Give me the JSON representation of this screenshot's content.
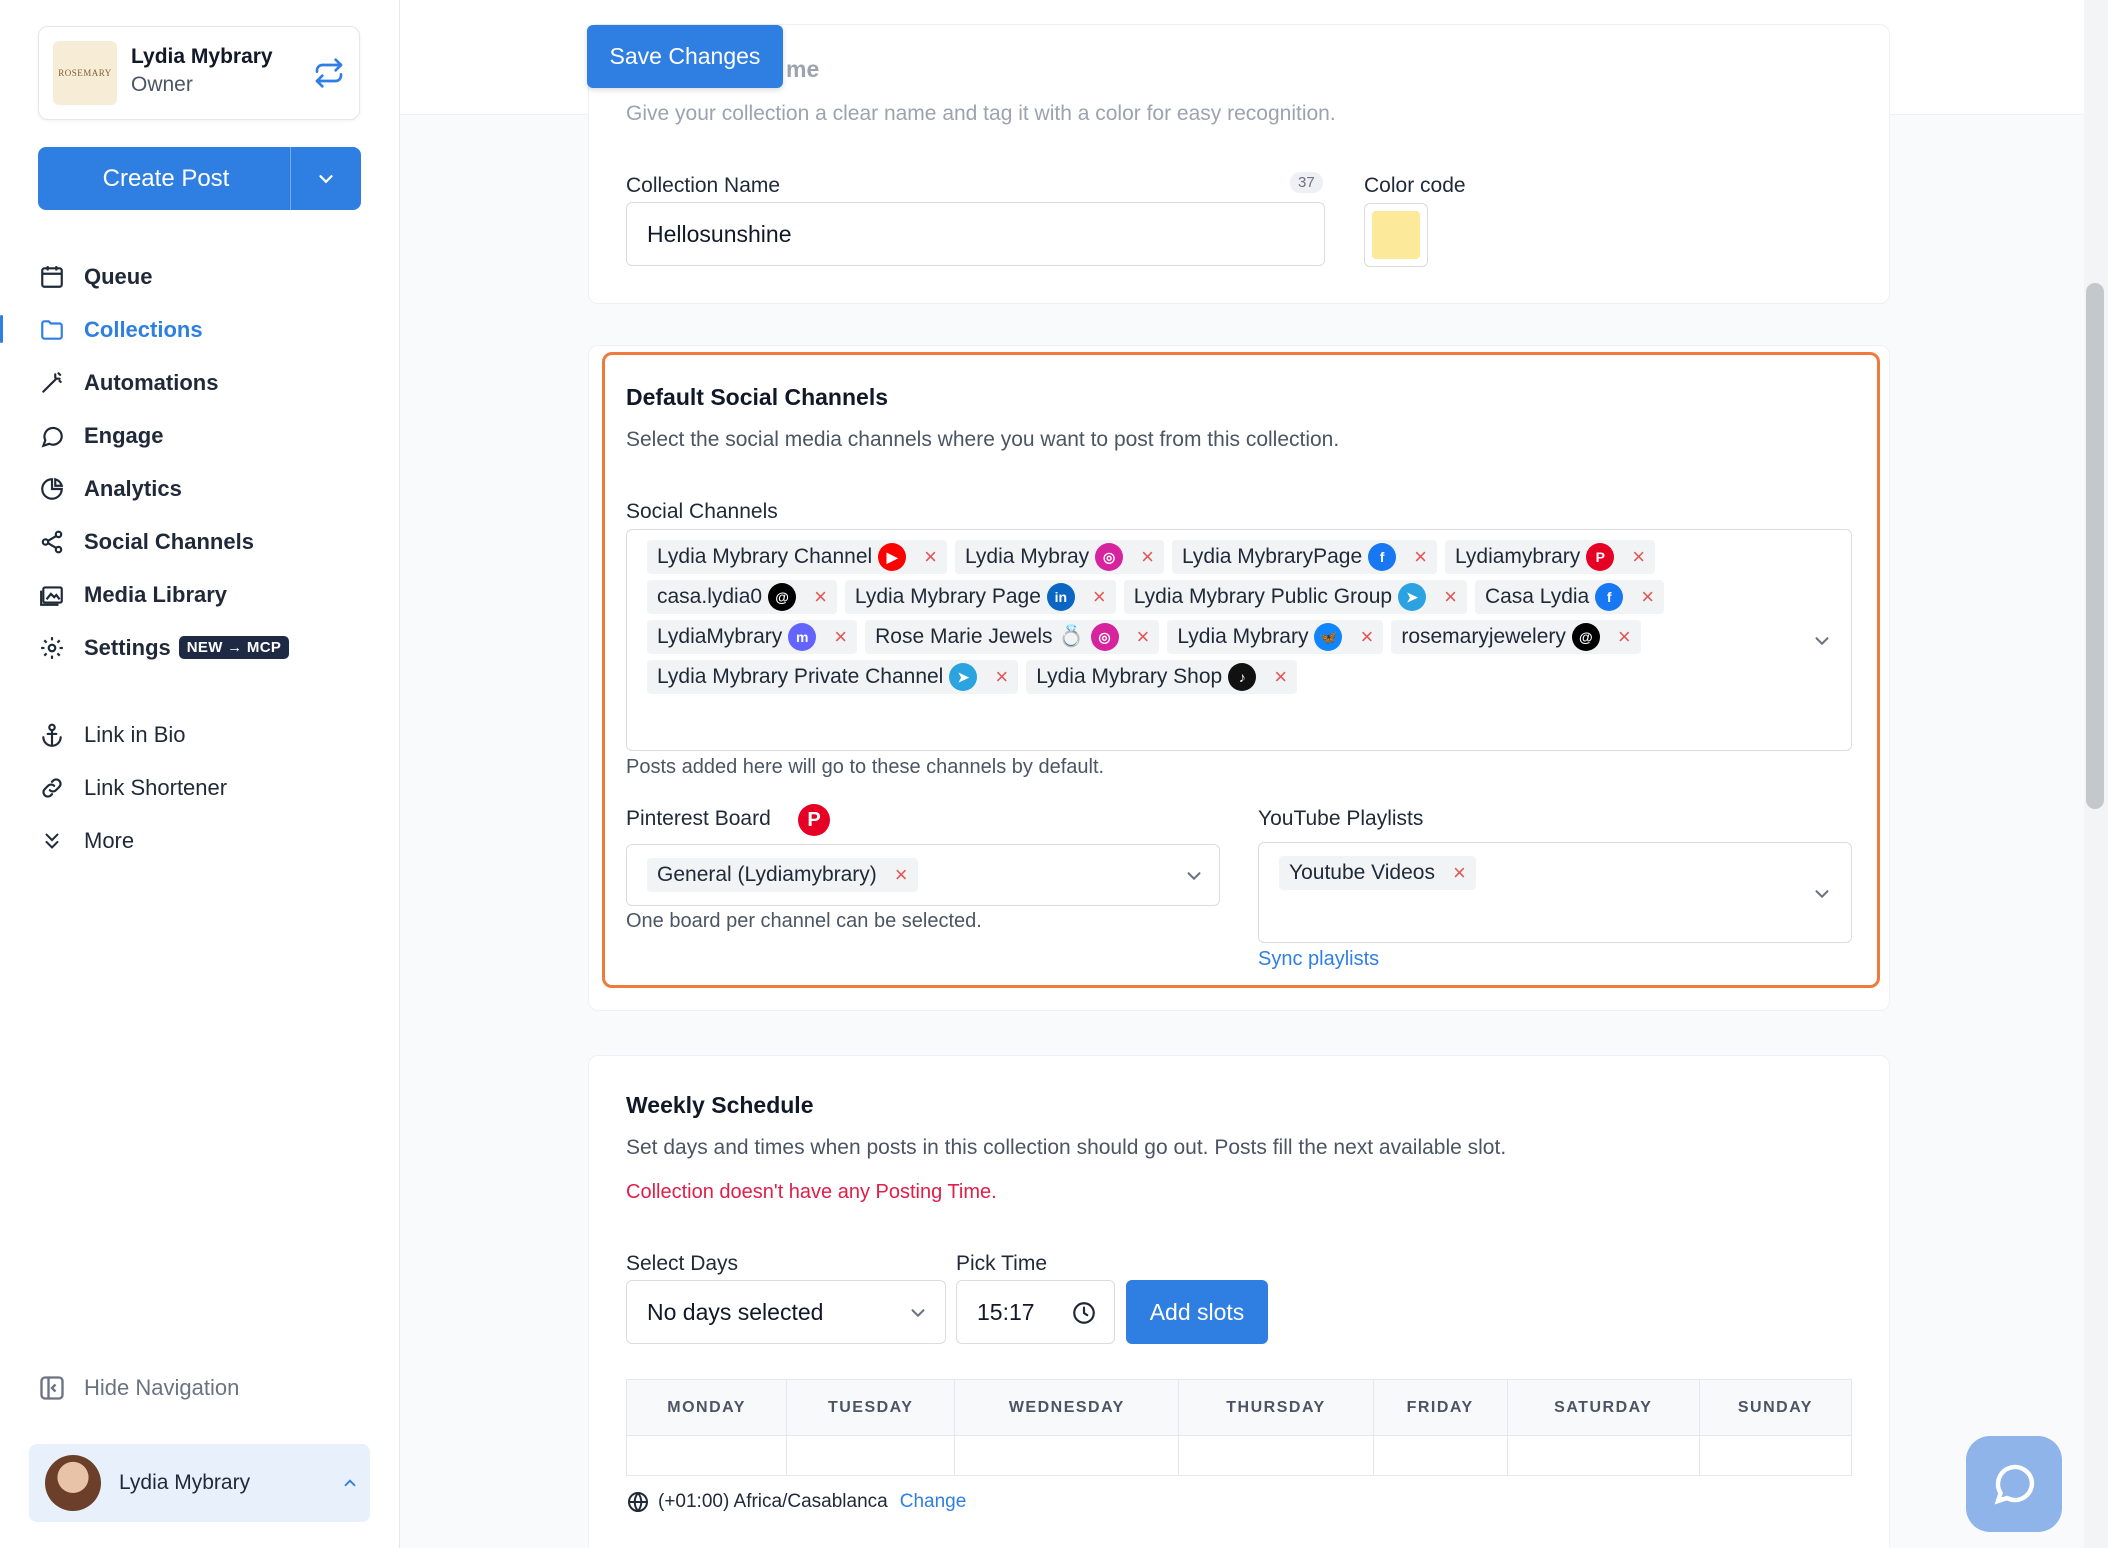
{
  "account": {
    "name": "Lydia Mybrary",
    "role": "Owner",
    "logo_text": "ROSEMARY"
  },
  "create_post": {
    "label": "Create Post"
  },
  "nav": {
    "queue": "Queue",
    "collections": "Collections",
    "automations": "Automations",
    "engage": "Engage",
    "analytics": "Analytics",
    "social_channels": "Social Channels",
    "media_library": "Media Library",
    "settings": "Settings",
    "settings_badge": "NEW → MCP",
    "link_in_bio": "Link in Bio",
    "link_shortener": "Link Shortener",
    "more": "More"
  },
  "hide_navigation": "Hide Navigation",
  "user": {
    "name": "Lydia Mybrary"
  },
  "toolbar": {
    "save_label": "Save Changes"
  },
  "name_section": {
    "title_fragment": "me",
    "description": "Give your collection a clear name and tag it with a color for easy recognition.",
    "collection_name_label": "Collection Name",
    "char_count": "37",
    "collection_name_value": "Hellosunshine",
    "color_code_label": "Color code",
    "color_value": "#fde99a"
  },
  "channels_section": {
    "title": "Default Social Channels",
    "description": "Select the social media channels where you want to post from this collection.",
    "social_channels_label": "Social Channels",
    "chips": [
      {
        "label": "Lydia Mybrary Channel",
        "icon": "youtube-icon",
        "color": "#ff0000",
        "glyph": "▶"
      },
      {
        "label": "Lydia Mybray",
        "icon": "instagram-icon",
        "color": "#d6249f",
        "glyph": "◎"
      },
      {
        "label": "Lydia MybraryPage",
        "icon": "facebook-icon",
        "color": "#1877f2",
        "glyph": "f"
      },
      {
        "label": "Lydiamybrary",
        "icon": "pinterest-icon",
        "color": "#e60023",
        "glyph": "P"
      },
      {
        "label": "casa.lydia0",
        "icon": "threads-icon",
        "color": "#000000",
        "glyph": "@"
      },
      {
        "label": "Lydia Mybrary Page",
        "icon": "linkedin-icon",
        "color": "#0a66c2",
        "glyph": "in"
      },
      {
        "label": "Lydia Mybrary Public Group",
        "icon": "telegram-icon",
        "color": "#2aa3e0",
        "glyph": "➤"
      },
      {
        "label": "Casa Lydia",
        "icon": "facebook-icon",
        "color": "#1877f2",
        "glyph": "f"
      },
      {
        "label": "LydiaMybrary",
        "icon": "mastodon-icon",
        "color": "#6364ff",
        "glyph": "m"
      },
      {
        "label": "Rose Marie Jewels 💍",
        "icon": "instagram-icon",
        "color": "#d6249f",
        "glyph": "◎"
      },
      {
        "label": "Lydia Mybrary",
        "icon": "bluesky-icon",
        "color": "#1185fe",
        "glyph": "🦋"
      },
      {
        "label": "rosemaryjewelery",
        "icon": "threads-icon",
        "color": "#000000",
        "glyph": "@"
      },
      {
        "label": "Lydia Mybrary Private Channel",
        "icon": "telegram-icon",
        "color": "#2aa3e0",
        "glyph": "➤"
      },
      {
        "label": "Lydia Mybrary Shop",
        "icon": "tiktok-icon",
        "color": "#111111",
        "glyph": "♪"
      }
    ],
    "channels_helper": "Posts added here will go to these channels by default.",
    "pinterest_label": "Pinterest Board",
    "pinterest_value": "General (Lydiamybrary)",
    "pinterest_helper": "One board per channel can be selected.",
    "youtube_label": "YouTube Playlists",
    "youtube_value": "Youtube Videos",
    "sync_link": "Sync playlists"
  },
  "schedule_section": {
    "title": "Weekly Schedule",
    "description": "Set days and times when posts in this collection should go out. Posts fill the next available slot.",
    "error": "Collection doesn't have any Posting Time.",
    "select_days_label": "Select Days",
    "select_days_value": "No days selected",
    "pick_time_label": "Pick Time",
    "pick_time_value": "15:17",
    "add_slots_label": "Add slots",
    "days": [
      "MONDAY",
      "TUESDAY",
      "WEDNESDAY",
      "THURSDAY",
      "FRIDAY",
      "SATURDAY",
      "SUNDAY"
    ],
    "timezone": "(+01:00) Africa/Casablanca",
    "change_link": "Change"
  }
}
